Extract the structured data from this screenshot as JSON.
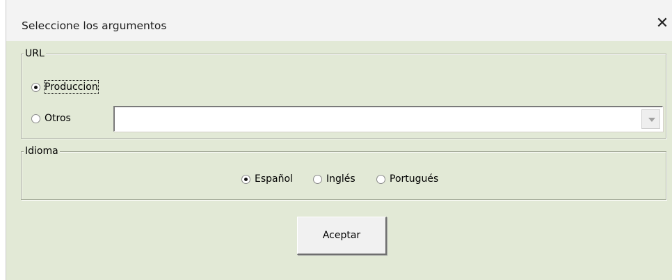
{
  "dialog": {
    "title": "Seleccione los argumentos"
  },
  "url_group": {
    "label": "URL",
    "options": [
      {
        "label": "Produccion",
        "selected": true
      },
      {
        "label": "Otros",
        "selected": false
      }
    ],
    "combo_value": ""
  },
  "language_group": {
    "label": "Idioma",
    "options": [
      {
        "label": "Español",
        "selected": true
      },
      {
        "label": "Inglés",
        "selected": false
      },
      {
        "label": "Portugués",
        "selected": false
      }
    ]
  },
  "buttons": {
    "accept": "Aceptar"
  },
  "icons": {
    "close": "close-icon",
    "combo_arrow": "chevron-down-icon"
  },
  "colors": {
    "client_background": "#e2e9d6",
    "title_background": "#f3f3f3"
  }
}
